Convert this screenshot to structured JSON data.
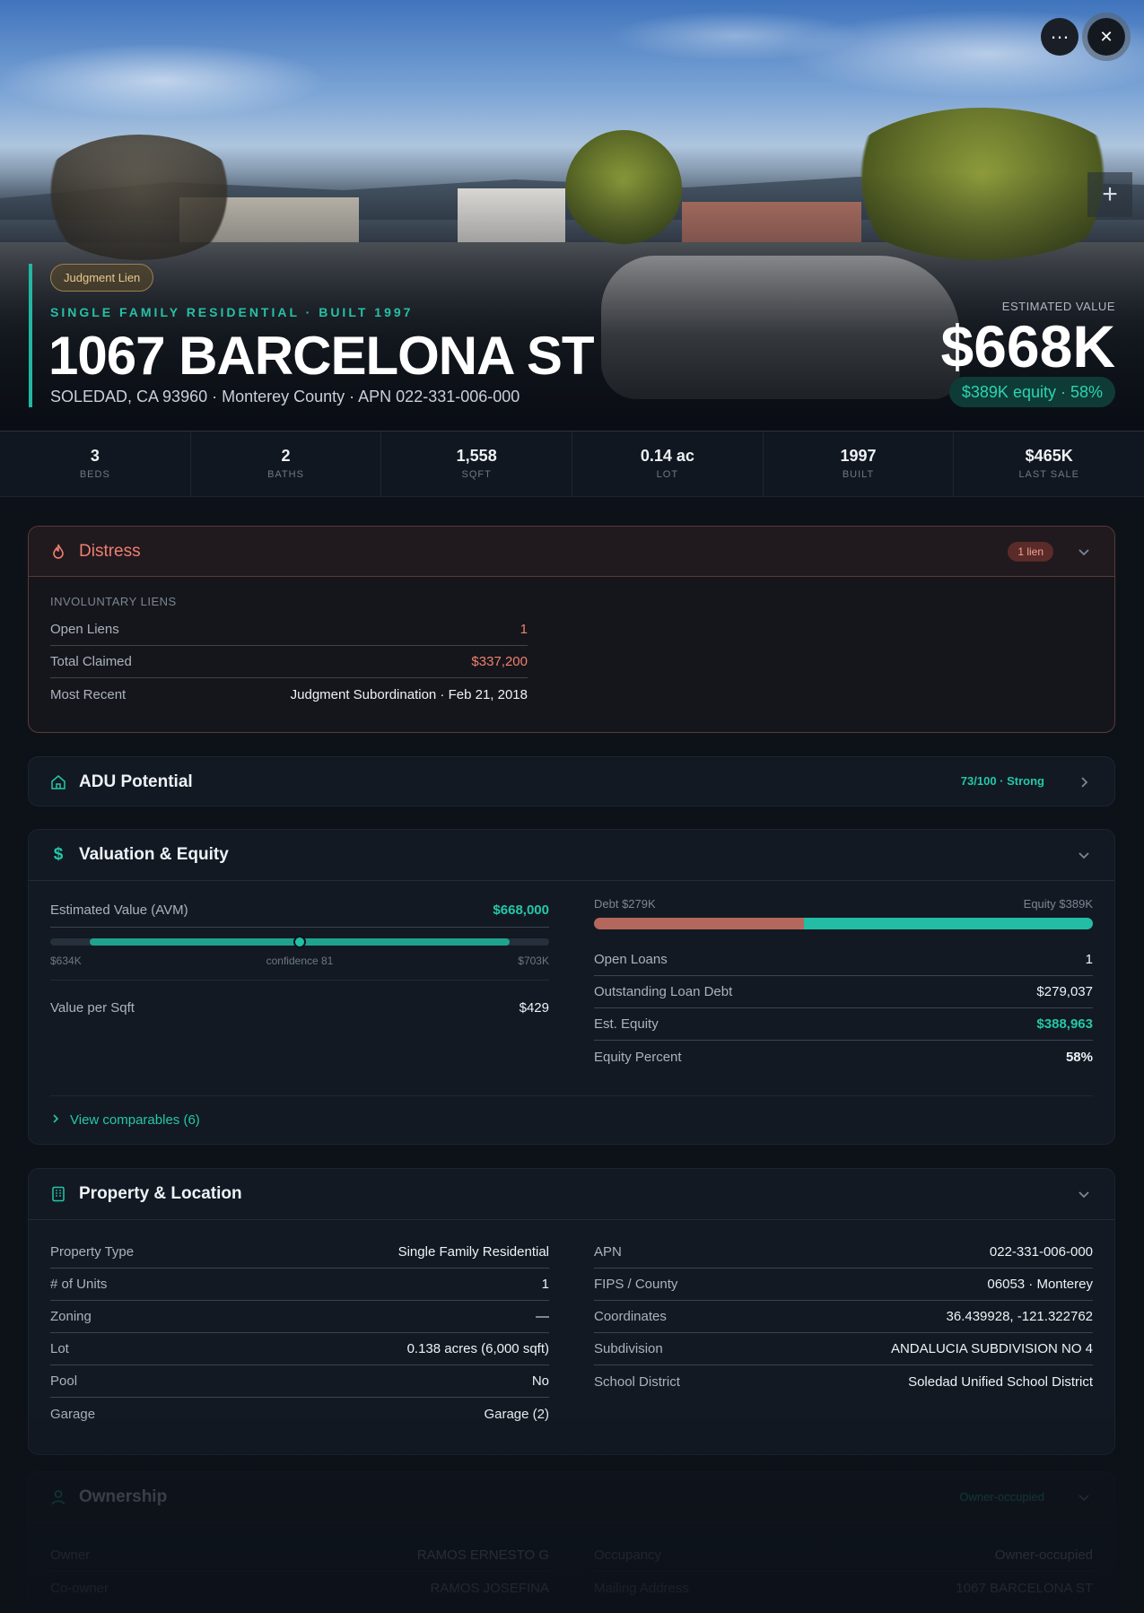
{
  "hero": {
    "badge": "Judgment Lien",
    "subtitle": "SINGLE FAMILY RESIDENTIAL · BUILT 1997",
    "title": "1067 BARCELONA ST",
    "address": "SOLEDAD, CA 93960 · Monterey County · APN 022-331-006-000",
    "est_label": "ESTIMATED VALUE",
    "est_value": "$668K",
    "equity": "$389K equity · 58%",
    "more_icon": "…",
    "close_icon": "✕",
    "zoom_icon": "+"
  },
  "stats": [
    {
      "value": "3",
      "label": "BEDS"
    },
    {
      "value": "2",
      "label": "BATHS"
    },
    {
      "value": "1,558",
      "label": "SQFT"
    },
    {
      "value": "0.14 ac",
      "label": "LOT"
    },
    {
      "value": "1997",
      "label": "BUILT"
    },
    {
      "value": "$465K",
      "label": "LAST SALE"
    }
  ],
  "distress": {
    "title": "Distress",
    "pill": "1 lien",
    "section": "INVOLUNTARY LIENS",
    "rows": [
      {
        "k": "Open Liens",
        "v": "1"
      },
      {
        "k": "Total Claimed",
        "v": "$337,200"
      },
      {
        "k": "Most Recent",
        "v": "Judgment Subordination · Feb 21, 2018"
      }
    ]
  },
  "adu": {
    "title": "ADU Potential",
    "score": "73/100 · Strong"
  },
  "valuation": {
    "title": "Valuation & Equity",
    "avm_label": "Estimated Value (AVM)",
    "avm_value": "$668,000",
    "range_low": "$634K",
    "range_mid": "confidence 81",
    "range_high": "$703K",
    "avm_position": 0.5,
    "vps_label": "Value per Sqft",
    "vps_value": "$429",
    "debt_label": "Debt $279K",
    "equity_label": "Equity $389K",
    "debt_fraction": 0.42,
    "rows": [
      {
        "k": "Open Loans",
        "v": "1"
      },
      {
        "k": "Outstanding Loan Debt",
        "v": "$279,037"
      },
      {
        "k": "Est. Equity",
        "v": "$388,963"
      },
      {
        "k": "Equity Percent",
        "v": "58%"
      }
    ],
    "comps": "View comparables (6)"
  },
  "property": {
    "title": "Property & Location",
    "left": [
      {
        "k": "Property Type",
        "v": "Single Family Residential"
      },
      {
        "k": "# of Units",
        "v": "1"
      },
      {
        "k": "Zoning",
        "v": "—"
      },
      {
        "k": "Lot",
        "v": "0.138 acres (6,000 sqft)"
      },
      {
        "k": "Pool",
        "v": "No"
      },
      {
        "k": "Garage",
        "v": "Garage (2)"
      }
    ],
    "right": [
      {
        "k": "APN",
        "v": "022-331-006-000"
      },
      {
        "k": "FIPS / County",
        "v": "06053 · Monterey"
      },
      {
        "k": "Coordinates",
        "v": "36.439928, -121.322762"
      },
      {
        "k": "Subdivision",
        "v": "ANDALUCIA SUBDIVISION NO 4"
      },
      {
        "k": "School District",
        "v": "Soledad Unified School District"
      }
    ]
  },
  "ownership": {
    "title": "Ownership",
    "badge": "Owner-occupied",
    "left": [
      {
        "k": "Owner",
        "v": "RAMOS ERNESTO G"
      },
      {
        "k": "Co-owner",
        "v": "RAMOS JOSEFINA"
      }
    ],
    "right": [
      {
        "k": "Occupancy",
        "v": "Owner-occupied"
      },
      {
        "k": "Mailing Address",
        "v": "1067 BARCELONA ST"
      }
    ]
  }
}
